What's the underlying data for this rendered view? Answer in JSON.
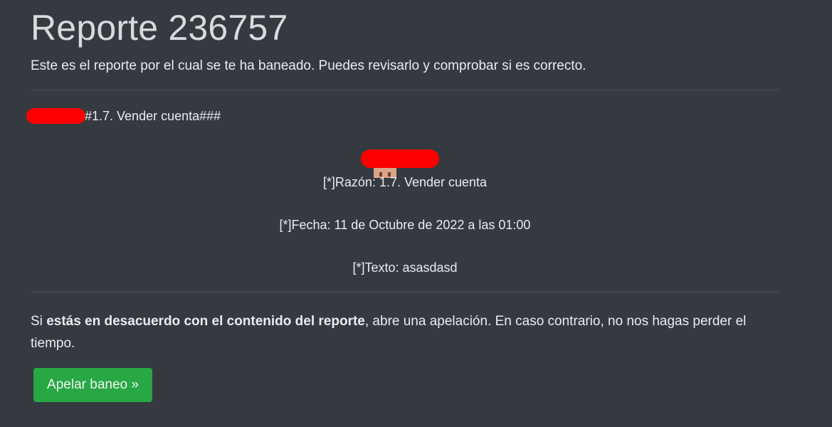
{
  "page": {
    "title": "Reporte 236757",
    "lead": "Este es el reporte por el cual se te ha baneado. Puedes revisarlo y comprobar si es correcto."
  },
  "report": {
    "header_text": "#1.7. Vender cuenta###",
    "razon": "[*]Razón: 1.7. Vender cuenta",
    "fecha": "[*]Fecha: 11 de Octubre de 2022 a las 01:00",
    "texto": "[*]Texto: asasdasd"
  },
  "notice": {
    "prefix": "Si ",
    "bold": "estás en desacuerdo con el contenido del reporte",
    "suffix": ", abre una apelación. En caso contrario, no nos hagas perder el tiempo."
  },
  "actions": {
    "appeal_label": "Apelar baneo »"
  },
  "colors": {
    "background": "#343a40",
    "button": "#28a745",
    "redaction": "#ff0000"
  }
}
